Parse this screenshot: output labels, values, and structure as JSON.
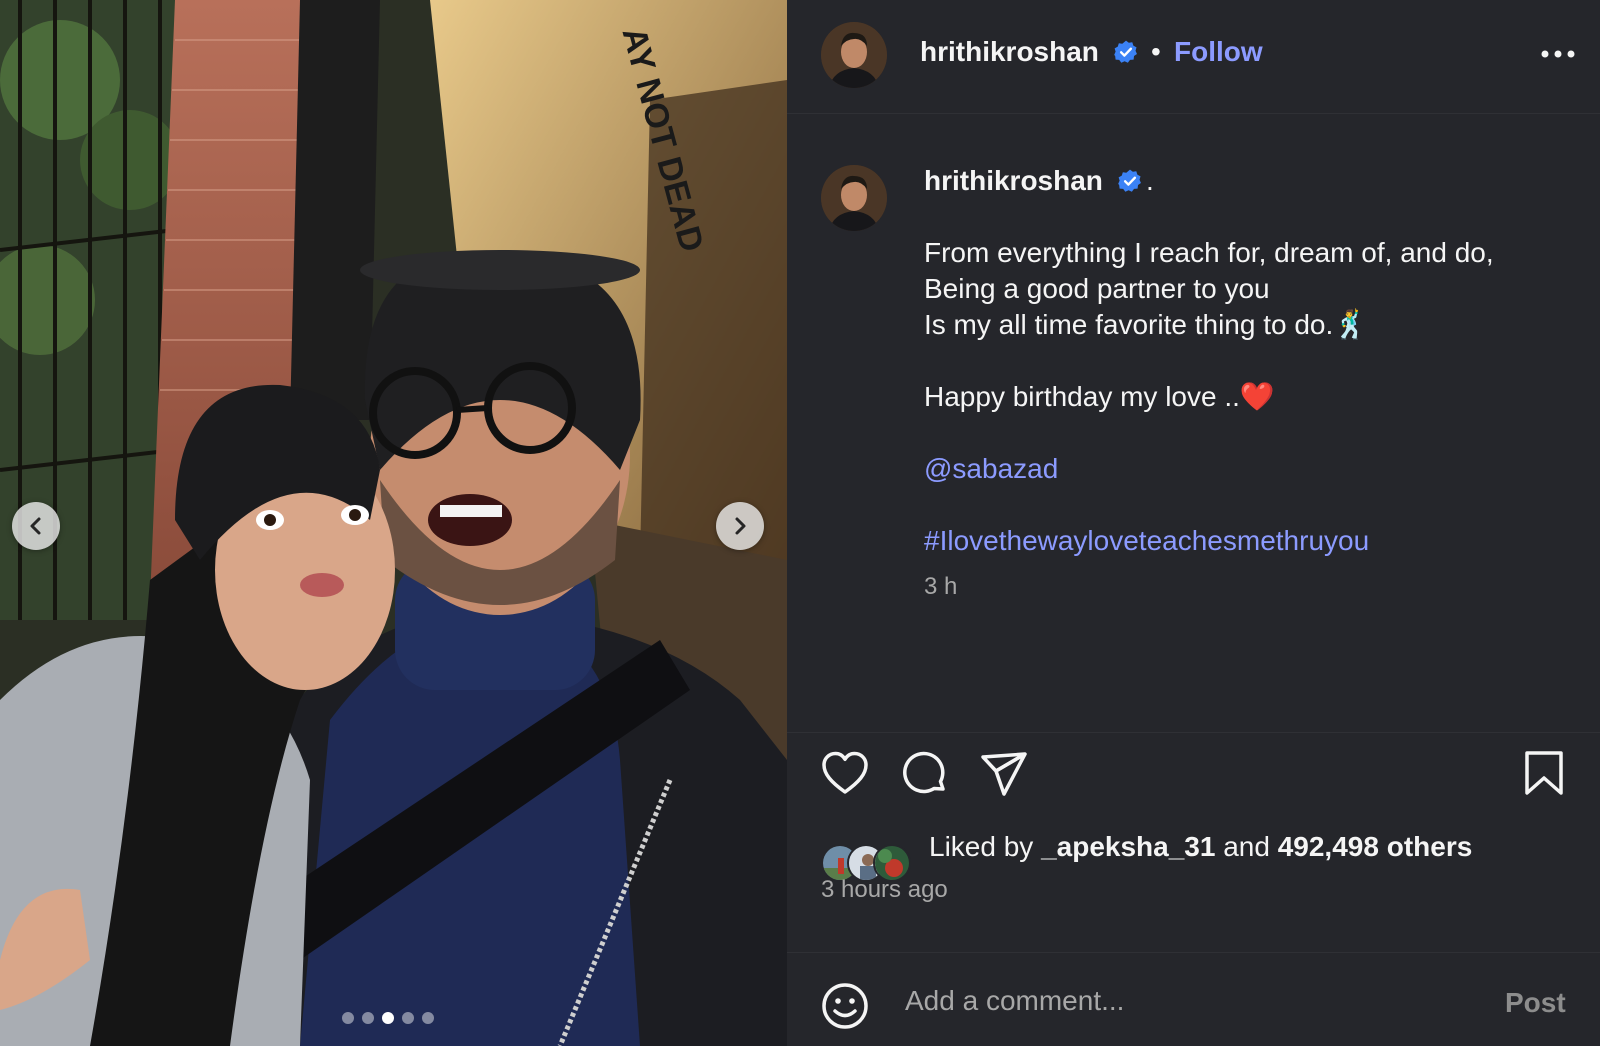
{
  "post": {
    "username": "hrithikroshan",
    "follow_label": "Follow",
    "separator": "•",
    "caption": {
      "username": "hrithikroshan",
      "trailing": ".",
      "lines": [
        "From everything I reach for, dream of, and do,",
        "Being a good partner to you",
        "Is my all time favorite thing to do.🕺",
        "Happy birthday my love ..❤️"
      ],
      "mention": "@sabazad",
      "hashtag": "#Ilovethewayloveteachesmethruyou",
      "time": "3 h"
    },
    "likes": {
      "prefix": "Liked by",
      "first_user": "_apeksha_31",
      "conjunction": "and",
      "others": "492,498 others"
    },
    "posted_ago": "3 hours ago",
    "comment": {
      "placeholder": "Add a comment...",
      "post_label": "Post"
    }
  },
  "carousel": {
    "total": 5,
    "active_index": 2,
    "overlay_text": "AY NOT DEAD"
  },
  "colors": {
    "panel_bg": "#25262b",
    "link": "#8c9bff",
    "verified": "#3b82f6",
    "muted": "#a8a8a8"
  },
  "icons": [
    "chevron-left-icon",
    "chevron-right-icon",
    "verified-badge-icon",
    "more-options-icon",
    "heart-icon",
    "comment-icon",
    "share-icon",
    "bookmark-icon",
    "emoji-icon"
  ]
}
